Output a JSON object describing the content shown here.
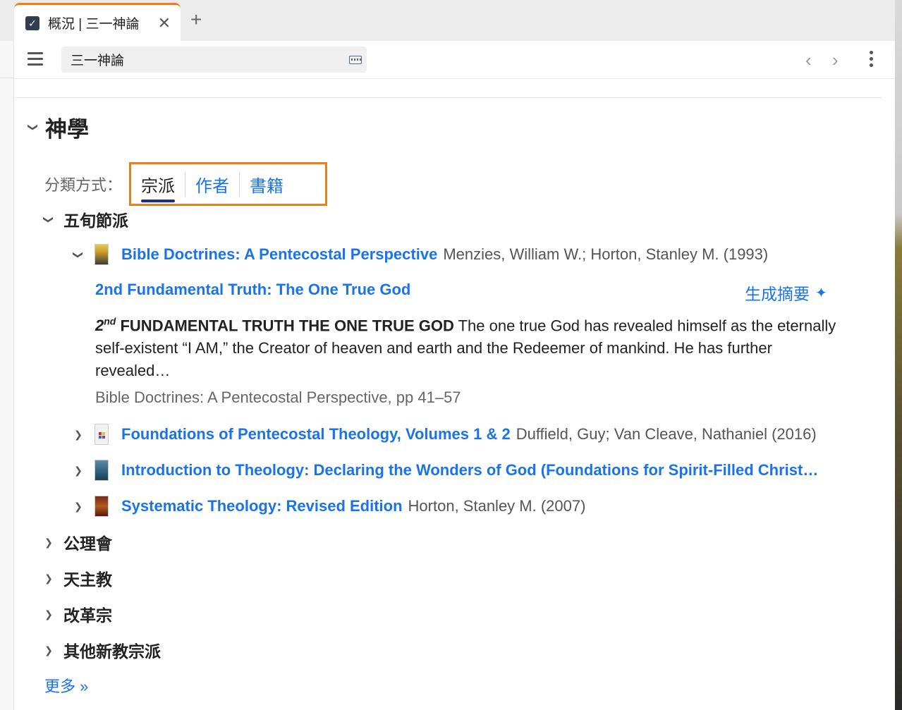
{
  "tab": {
    "title": "概況 | 三一神論",
    "close_symbol": "✕",
    "new_tab_symbol": "+",
    "icon": "checkbox-icon"
  },
  "toolbar": {
    "search_value": "三一神論",
    "menu_icon": "hamburger-icon",
    "keyboard_icon": "keyboard-icon",
    "prev_symbol": "‹",
    "next_symbol": "›"
  },
  "section": {
    "title": "神學"
  },
  "classify": {
    "label": "分類方式：",
    "options": [
      "宗派",
      "作者",
      "書籍"
    ],
    "active": "宗派"
  },
  "groups": [
    {
      "label": "五旬節派",
      "expanded": true
    },
    {
      "label": "公理會",
      "expanded": false
    },
    {
      "label": "天主教",
      "expanded": false
    },
    {
      "label": "改革宗",
      "expanded": false
    },
    {
      "label": "其他新教宗派",
      "expanded": false
    }
  ],
  "books": [
    {
      "title": "Bible Doctrines: A Pentecostal Perspective",
      "meta": "Menzies, William W.; Horton, Stanley M. (1993)",
      "expanded": true
    },
    {
      "title": "Foundations of Pentecostal Theology, Volumes 1 & 2",
      "meta": "Duffield, Guy; Van Cleave, Nathaniel (2016)",
      "expanded": false
    },
    {
      "title": "Introduction to Theology: Declaring the Wonders of God (Foundations for Spirit-Filled Christ…",
      "meta": "",
      "expanded": false
    },
    {
      "title": "Systematic Theology: Revised Edition",
      "meta": "Horton, Stanley M. (2007)",
      "expanded": false
    }
  ],
  "article": {
    "title": "2nd Fundamental Truth: The One True God",
    "generate_summary": "生成摘要",
    "excerpt_ordinal": "2",
    "excerpt_ordinal_suffix": "nd",
    "excerpt_heading": "FUNDAMENTAL TRUTH THE ONE TRUE GOD",
    "excerpt_body": "The one true God has revealed himself as the eternally self-existent “I AM,” the Creator of heaven and earth and the Redeemer of mankind. He has further revealed…",
    "source": "Bible Doctrines: A Pentecostal Perspective, pp 41–57"
  },
  "more_link": "更多 »",
  "colors": {
    "accent": "#1a73e8",
    "highlight_border": "#f07d1a",
    "active_underline": "#1c2e8c"
  }
}
